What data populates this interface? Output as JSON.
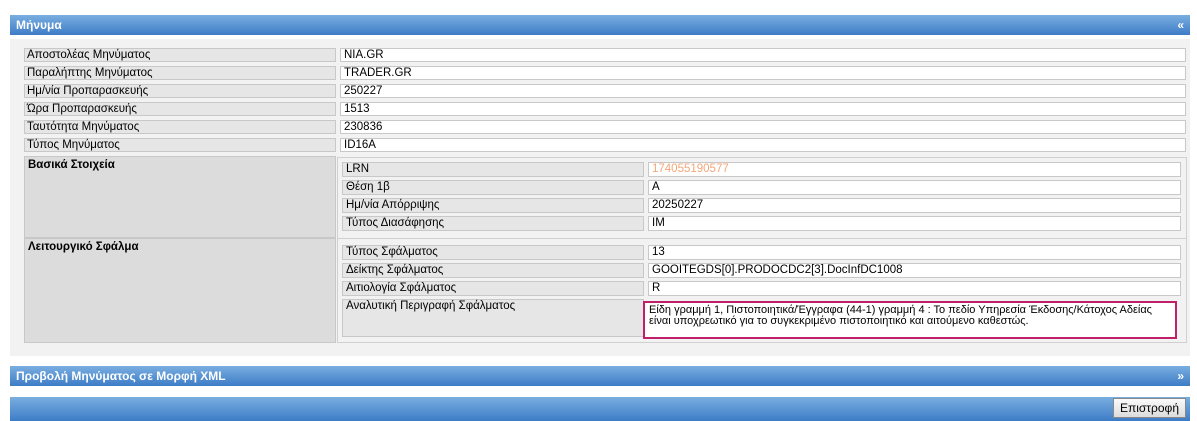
{
  "message": {
    "title": "Μήνυμα",
    "toggle": "«",
    "fields": [
      {
        "label": "Αποστολέας Μηνύματος",
        "value": "NIA.GR"
      },
      {
        "label": "Παραλήπτης Μηνύματος",
        "value": "TRADER.GR"
      },
      {
        "label": "Ημ/νία Προπαρασκευής",
        "value": "250227"
      },
      {
        "label": "Ώρα Προπαρασκευής",
        "value": "1513"
      },
      {
        "label": "Ταυτότητα Μηνύματος",
        "value": "230836"
      },
      {
        "label": "Τύπος Μηνύματος",
        "value": "ID16A"
      }
    ],
    "basic": {
      "title": "Βασικά Στοιχεία",
      "fields": [
        {
          "label": "LRN",
          "value": "174055190577"
        },
        {
          "label": "Θέση 1β",
          "value": "A"
        },
        {
          "label": "Ημ/νία Απόρριψης",
          "value": "20250227"
        },
        {
          "label": "Τύπος Διασάφησης",
          "value": "IM"
        }
      ]
    },
    "error": {
      "title": "Λειτουργικό Σφάλμα",
      "fields": [
        {
          "label": "Τύπος Σφάλματος",
          "value": "13"
        },
        {
          "label": "Δείκτης Σφάλματος",
          "value": "GOOITEGDS[0].PRODOCDC2[3].DocInfDC1008"
        },
        {
          "label": "Αιτιολογία Σφάλματος",
          "value": "R"
        },
        {
          "label": "Αναλυτική Περιγραφή Σφάλματος",
          "value": "Είδη γραμμή 1, Πιστοποιητικά/Έγγραφα (44-1) γραμμή 4 : Το πεδίο Υπηρεσία Έκδοσης/Κάτοχος Αδείας είναι υποχρεωτικό για το συγκεκριμένο πιστοποιητικό και αιτούμενο καθεστώς."
        }
      ]
    }
  },
  "xml": {
    "title": "Προβολή Μηνύματος σε Μορφή XML",
    "toggle": "»"
  },
  "footer": {
    "return_label": "Επιστροφή"
  },
  "colors": {
    "header_gradient_top": "#79aee0",
    "header_gradient_bottom": "#3d7cc6",
    "highlight_border": "#c0206a"
  }
}
